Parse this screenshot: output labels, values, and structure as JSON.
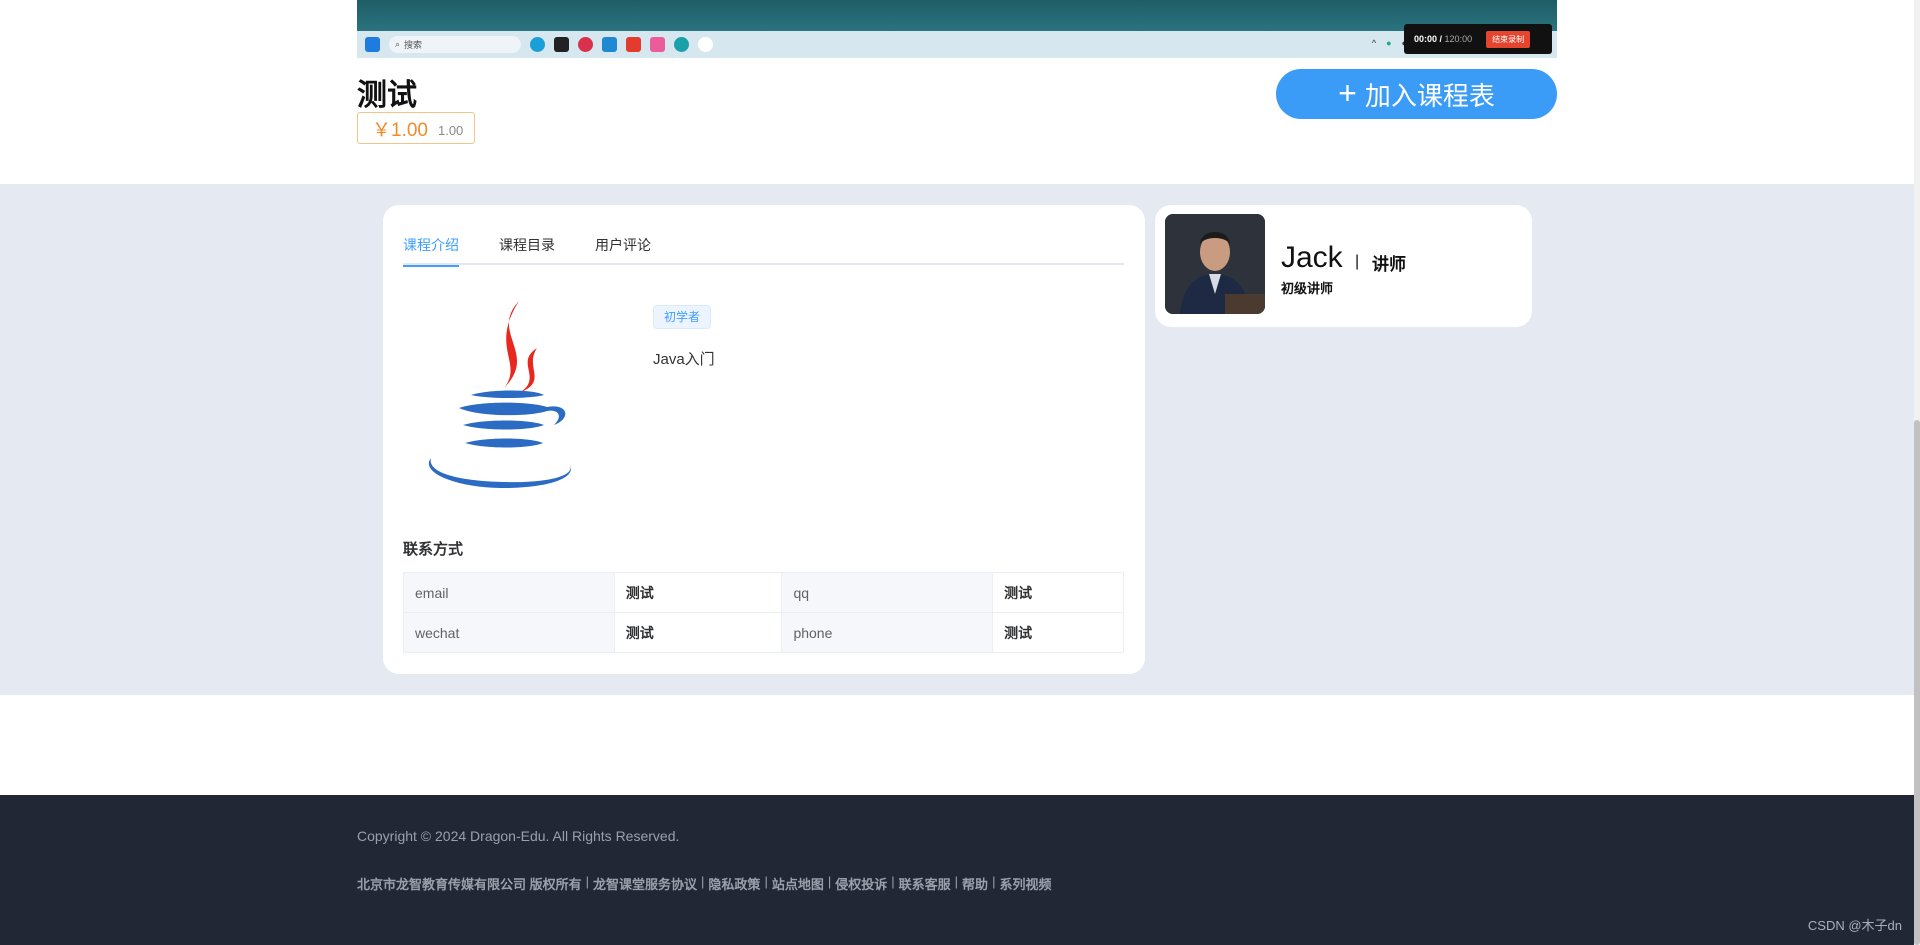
{
  "video": {
    "taskbar": {
      "search_placeholder": "搜索"
    },
    "recorder": {
      "time_current": "00:00",
      "time_sep": " / ",
      "time_total": "120:00",
      "stop_label": "结束录制"
    }
  },
  "course": {
    "title": "测试",
    "price": "￥1.00",
    "original_price": "1.00",
    "join_button": "加入课程表",
    "join_icon": "+"
  },
  "tabs": [
    {
      "label": "课程介绍",
      "active": true
    },
    {
      "label": "课程目录",
      "active": false
    },
    {
      "label": "用户评论",
      "active": false
    }
  ],
  "intro": {
    "level_tag": "初学者",
    "description": "Java入门",
    "contact_title": "联系方式",
    "contact": [
      [
        {
          "label": "email",
          "value": "测试"
        },
        {
          "label": "qq",
          "value": "测试"
        }
      ],
      [
        {
          "label": "wechat",
          "value": "测试"
        },
        {
          "label": "phone",
          "value": "测试"
        }
      ]
    ]
  },
  "teacher": {
    "name": "Jack",
    "separator": "|",
    "role": "讲师",
    "level": "初级讲师"
  },
  "footer": {
    "copyright": "Copyright © 2024 Dragon-Edu. All Rights Reserved.",
    "links": [
      "北京市龙智教育传媒有限公司 版权所有",
      "龙智课堂服务协议",
      "隐私政策",
      "站点地图",
      "侵权投诉",
      "联系客服",
      "帮助",
      "系列视频"
    ],
    "link_sep": "|",
    "watermark": "CSDN @木子dn"
  },
  "colors": {
    "accent": "#409eff",
    "join_button": "#3a9cf6",
    "price": "#f08c2a",
    "grey_bg": "#e5e9f2",
    "footer_bg": "#222735"
  }
}
